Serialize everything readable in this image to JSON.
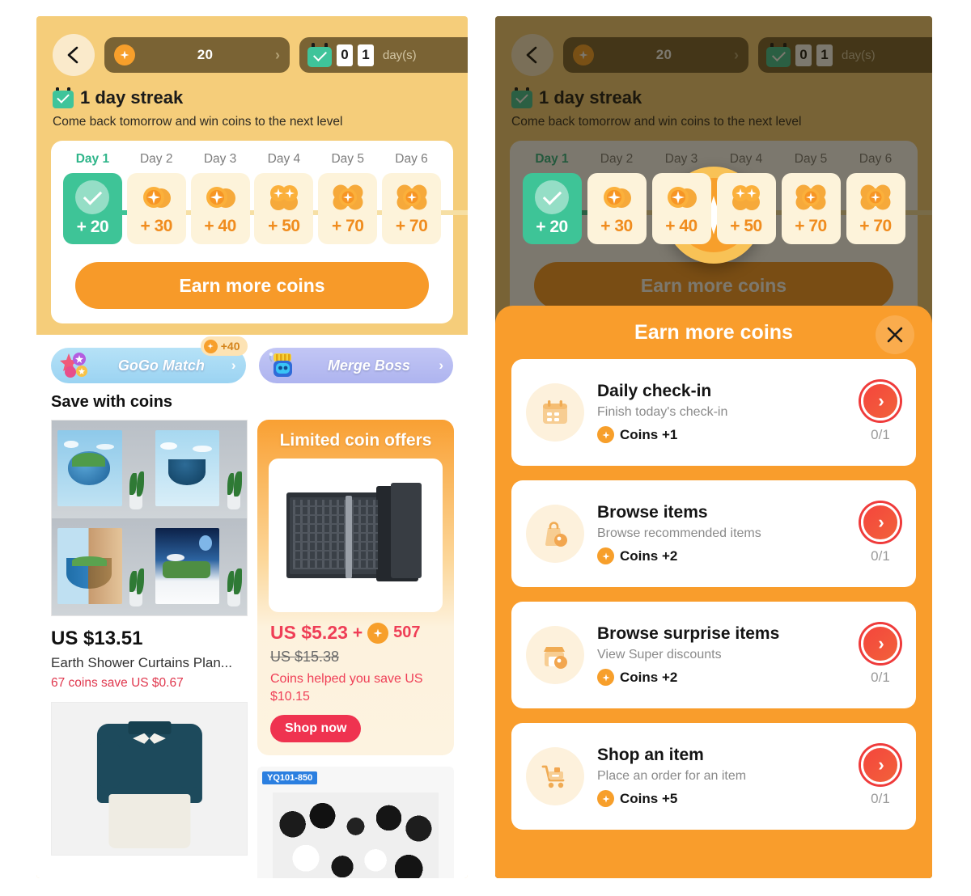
{
  "header": {
    "back_icon": "arrow-left-icon",
    "coins_value": "20",
    "coins_chevron": "›",
    "days_digit_1": "0",
    "days_digit_2": "1",
    "days_label": "day(s)",
    "streak_title": "1 day streak",
    "streak_sub": "Come back tomorrow and win coins to the next level"
  },
  "days_card": {
    "labels": [
      "Day 1",
      "Day 2",
      "Day 3",
      "Day 4",
      "Day 5",
      "Day 6"
    ],
    "rewards": [
      "+ 20",
      "+ 30",
      "+ 40",
      "+ 50",
      "+ 70",
      "+ 70"
    ],
    "completed_index": 0
  },
  "earn_button": {
    "label": "Earn more coins"
  },
  "games": [
    {
      "name": "GoGo Match",
      "badge": "+40",
      "icon": "gem-cluster-icon",
      "chevron": "›"
    },
    {
      "name": "Merge Boss",
      "badge": "",
      "icon": "robot-icon",
      "chevron": "›"
    }
  ],
  "save_section": {
    "title": "Save with coins"
  },
  "product": {
    "price": "US $13.51",
    "name": "Earth Shower Curtains Plan...",
    "save_text": "67 coins save US $0.67"
  },
  "offer": {
    "title": "Limited coin offers",
    "price": "US $5.23",
    "plus": "+",
    "coins": "507",
    "original_price": "US $15.38",
    "help_text": "Coins helped you save US $10.15",
    "cta": "Shop now"
  },
  "sticker": {
    "sku": "YQ101-850"
  },
  "modal": {
    "title": "Earn more coins",
    "close_icon": "close-icon",
    "tasks": [
      {
        "title": "Daily check-in",
        "desc": "Finish today's check-in",
        "reward": "Coins +1",
        "progress": "0/1",
        "icon": "calendar-icon"
      },
      {
        "title": "Browse items",
        "desc": "Browse recommended items",
        "reward": "Coins +2",
        "progress": "0/1",
        "icon": "shopping-bag-tag-icon"
      },
      {
        "title": "Browse surprise items",
        "desc": "View Super discounts",
        "reward": "Coins +2",
        "progress": "0/1",
        "icon": "storefront-tag-icon"
      },
      {
        "title": "Shop an item",
        "desc": "Place an order for an item",
        "reward": "Coins +5",
        "progress": "0/1",
        "icon": "shopping-cart-icon"
      }
    ]
  },
  "colors": {
    "panel_bg": "#f5cd7a",
    "accent_orange": "#f79a29",
    "coin_orange": "#f79f2b",
    "green": "#3ec497",
    "red": "#ef3350",
    "dim_overlay": "rgba(30,22,5,.58)"
  }
}
